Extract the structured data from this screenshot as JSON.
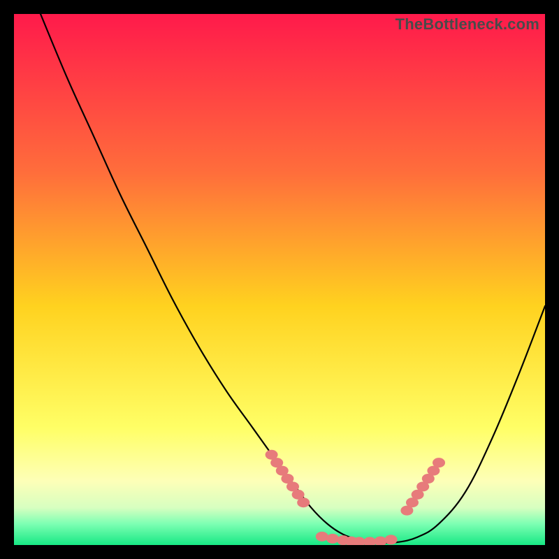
{
  "watermark": "TheBottleneck.com",
  "colors": {
    "gradient_top": "#ff1a4b",
    "gradient_mid1": "#ff6e3b",
    "gradient_mid2": "#ffd21f",
    "gradient_mid3": "#ffff66",
    "gradient_mid4": "#fdffb8",
    "gradient_mid5": "#d7ffc0",
    "gradient_mid6": "#7dffb3",
    "gradient_bottom": "#17e884",
    "curve": "#000000",
    "dots": "#e77b7b"
  },
  "chart_data": {
    "type": "line",
    "title": "",
    "xlabel": "",
    "ylabel": "",
    "xlim": [
      0,
      100
    ],
    "ylim": [
      0,
      100
    ],
    "series": [
      {
        "name": "bottleneck-curve",
        "x": [
          5,
          10,
          15,
          20,
          25,
          30,
          35,
          40,
          45,
          50,
          53,
          56,
          59,
          62,
          65,
          68,
          72,
          76,
          80,
          85,
          90,
          95,
          100
        ],
        "y": [
          100,
          88,
          77,
          66,
          56,
          46,
          37,
          29,
          22,
          15,
          11,
          7,
          4,
          2,
          1,
          0.5,
          0.5,
          1.5,
          4,
          10,
          20,
          32,
          45
        ]
      },
      {
        "name": "highlight-dots-left",
        "x": [
          48.5,
          49.5,
          50.5,
          51.5,
          52.5,
          53.5,
          54.5
        ],
        "y": [
          17,
          15.5,
          14,
          12.5,
          11,
          9.5,
          8
        ]
      },
      {
        "name": "highlight-dots-bottom",
        "x": [
          58,
          60,
          62,
          63.5,
          65,
          67,
          69,
          71
        ],
        "y": [
          1.6,
          1.2,
          0.9,
          0.7,
          0.6,
          0.6,
          0.7,
          1.0
        ]
      },
      {
        "name": "highlight-dots-right",
        "x": [
          74,
          75,
          76,
          77,
          78,
          79,
          80
        ],
        "y": [
          6.5,
          8,
          9.5,
          11,
          12.5,
          14,
          15.5
        ]
      }
    ],
    "annotations": []
  }
}
